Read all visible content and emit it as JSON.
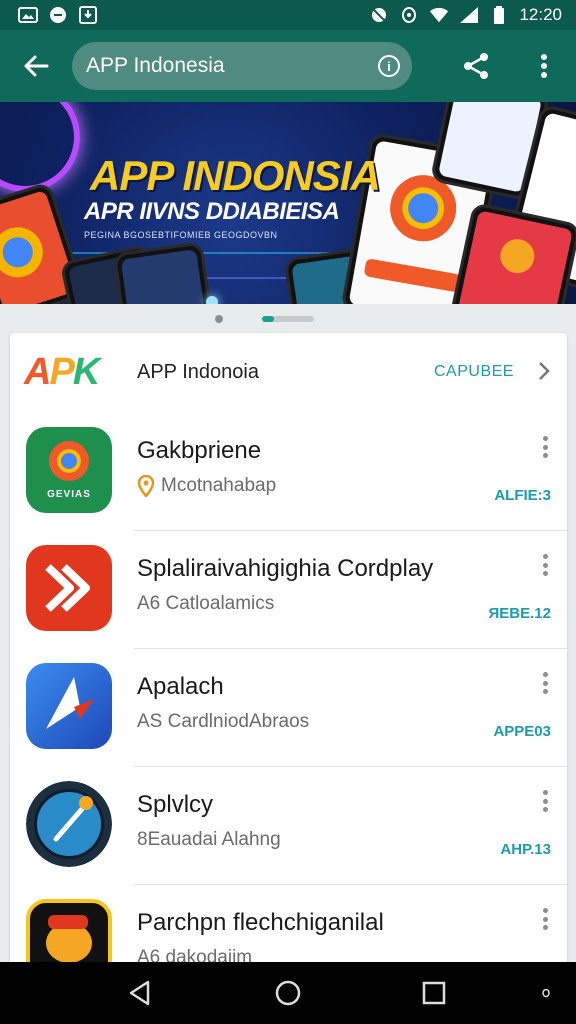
{
  "status_bar": {
    "time": "12:20",
    "icons": [
      "photo-icon",
      "message-icon",
      "download-icon",
      "mute-icon",
      "sync-icon",
      "wifi-icon",
      "signal-icon",
      "battery-icon"
    ]
  },
  "app_bar": {
    "back_icon": "arrow-back-icon",
    "search_text": "APP Indonesia",
    "info_icon": "info-icon",
    "share_icon": "share-icon",
    "more_icon": "more-vert-icon"
  },
  "banner": {
    "title": "APP INDONSIA",
    "subtitle": "APR IIVNS DDIABIEISA",
    "small_text": "PEGINA BGOSEBTIFOMIEB GEOGDOVBN"
  },
  "pager": {
    "count": 2,
    "active": 1
  },
  "card_header": {
    "logo_text": "APK",
    "title": "APP Indonoia",
    "action": "CAPUBEE"
  },
  "apps": [
    {
      "title": "Gakbpriene",
      "subtitle": "Mcotnahabap",
      "subtitle_icon": "location-pin-icon",
      "tag": "ALFIE:3",
      "icon_bg": "#1f8f4e",
      "icon_caption": "GEVIAS"
    },
    {
      "title": "Splalirаivahigighia Cordplay",
      "subtitle": "A6  Catlоalamics",
      "tag": "ЯЕВЕ.12",
      "icon_bg": "#e2371f"
    },
    {
      "title": "Apalach",
      "subtitle": "AS CardlniodAbraos",
      "tag": "APPE03",
      "icon_bg": "#2563c9"
    },
    {
      "title": "Splvlcy",
      "subtitle": "8Eauadai Alahng",
      "tag": "AHP.13",
      "icon_bg": "#1d2e3f"
    },
    {
      "title": "Parchpn flechchiganilal",
      "subtitle": "A6  dakodaiim",
      "tag": "",
      "icon_bg": "#f5c518"
    }
  ],
  "nav_bar": {
    "back_icon": "nav-back-icon",
    "home_icon": "nav-home-icon",
    "recents_icon": "nav-recents-icon",
    "extra_icon": "nav-dot-icon"
  }
}
